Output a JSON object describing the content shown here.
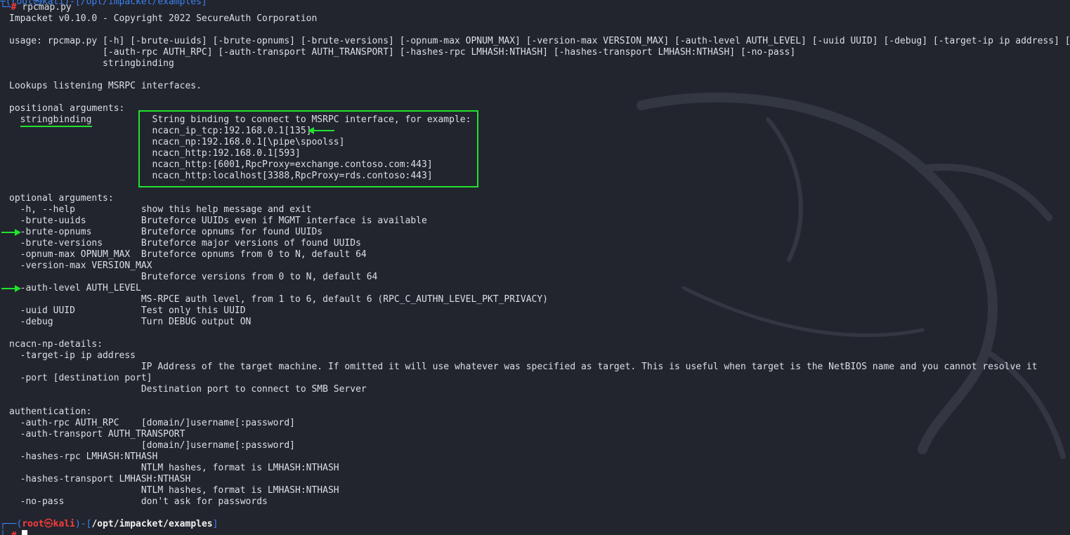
{
  "colors": {
    "background": "#22252e",
    "text": "#dcdfe4",
    "annotation_green": "#22e12f",
    "prompt_blue": "#3b82f6",
    "prompt_red": "#ff3b3b"
  },
  "icons": {
    "watermark": "kali-dragon-watermark",
    "arrow": "green-arrow"
  },
  "command": {
    "frame": "└─",
    "hash": "#",
    "text": " rpcmap.py"
  },
  "output_lines": [
    "Impacket v0.10.0 - Copyright 2022 SecureAuth Corporation",
    "",
    "usage: rpcmap.py [-h] [-brute-uuids] [-brute-opnums] [-brute-versions] [-opnum-max OPNUM_MAX] [-version-max VERSION_MAX] [-auth-level AUTH_LEVEL] [-uuid UUID] [-debug] [-target-ip ip address] [-port [destination port]]",
    "                 [-auth-rpc AUTH_RPC] [-auth-transport AUTH_TRANSPORT] [-hashes-rpc LMHASH:NTHASH] [-hashes-transport LMHASH:NTHASH] [-no-pass]",
    "                 stringbinding",
    "",
    "Lookups listening MSRPC interfaces.",
    "",
    "positional arguments:",
    "  stringbinding           String binding to connect to MSRPC interface, for example:",
    "                          ncacn_ip_tcp:192.168.0.1[135]",
    "                          ncacn_np:192.168.0.1[\\pipe\\spoolss]",
    "                          ncacn_http:192.168.0.1[593]",
    "                          ncacn_http:[6001,RpcProxy=exchange.contoso.com:443]",
    "                          ncacn_http:localhost[3388,RpcProxy=rds.contoso:443]",
    "",
    "optional arguments:",
    "  -h, --help            show this help message and exit",
    "  -brute-uuids          Bruteforce UUIDs even if MGMT interface is available",
    "  -brute-opnums         Bruteforce opnums for found UUIDs",
    "  -brute-versions       Bruteforce major versions of found UUIDs",
    "  -opnum-max OPNUM_MAX  Bruteforce opnums from 0 to N, default 64",
    "  -version-max VERSION_MAX",
    "                        Bruteforce versions from 0 to N, default 64",
    "  -auth-level AUTH_LEVEL",
    "                        MS-RPCE auth level, from 1 to 6, default 6 (RPC_C_AUTHN_LEVEL_PKT_PRIVACY)",
    "  -uuid UUID            Test only this UUID",
    "  -debug                Turn DEBUG output ON",
    "",
    "ncacn-np-details:",
    "  -target-ip ip address",
    "                        IP Address of the target machine. If omitted it will use whatever was specified as target. This is useful when target is the NetBIOS name and you cannot resolve it",
    "  -port [destination port]",
    "                        Destination port to connect to SMB Server",
    "",
    "authentication:",
    "  -auth-rpc AUTH_RPC    [domain/]username[:password]",
    "  -auth-transport AUTH_TRANSPORT",
    "                        [domain/]username[:password]",
    "  -hashes-rpc LMHASH:NTHASH",
    "                        NTLM hashes, format is LMHASH:NTHASH",
    "  -hashes-transport LMHASH:NTHASH",
    "                        NTLM hashes, format is LMHASH:NTHASH",
    "  -no-pass              don't ask for passwords",
    ""
  ],
  "prompt": {
    "frame_open": "┌──(",
    "user": "root",
    "at": "㉿",
    "host": "kali",
    "frame_mid": ")-[",
    "path": "/opt/impacket/examples",
    "frame_close": "]",
    "frame_second": "└─",
    "hash": "#"
  }
}
